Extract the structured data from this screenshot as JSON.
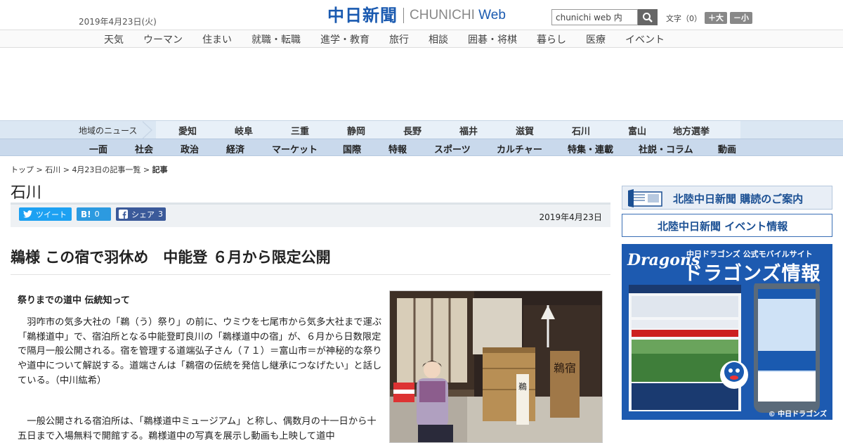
{
  "header": {
    "date": "2019年4月23日(火)",
    "logo_jp": "中日新聞",
    "logo_en_prefix": "CHUNICHI",
    "logo_en_suffix": "Web",
    "search_value": "chunichi web 内",
    "fontsize_label": "文字（0）",
    "font_larger": "＋大",
    "font_smaller": "－小"
  },
  "nav_top": [
    "天気",
    "ウーマン",
    "住まい",
    "就職・転職",
    "進学・教育",
    "旅行",
    "相談",
    "囲碁・将棋",
    "暮らし",
    "医療",
    "イベント"
  ],
  "nav_region": {
    "label": "地域のニュース",
    "items": [
      "愛知",
      "岐阜",
      "三重",
      "静岡",
      "長野",
      "福井",
      "滋賀",
      "石川",
      "富山",
      "地方選挙"
    ]
  },
  "nav_category": [
    "一面",
    "社会",
    "政治",
    "経済",
    "マーケット",
    "国際",
    "特報",
    "スポーツ",
    "カルチャー",
    "特集・連載",
    "社説・コラム",
    "動画"
  ],
  "breadcrumb": {
    "top": "トップ",
    "region": "石川",
    "list": "4月23日の記事一覧",
    "current": "記事",
    "sep": " > "
  },
  "section_title": "石川",
  "share": {
    "tweet": "ツイート",
    "hatena_count": "0",
    "facebook": "シェア",
    "facebook_count": "3",
    "date": "2019年4月23日"
  },
  "article": {
    "headline": "鵜様 この宿で羽休め　中能登 ６月から限定公開",
    "subhead": "祭りまでの道中 伝統知って",
    "p1": "　羽咋市の気多大社の「鵜（う）祭り」の前に、ウミウを七尾市から気多大社まで運ぶ「鵜様道中」で、宿泊所となる中能登町良川の「鵜様道中の宿」が、６月から日数限定で隔月一般公開される。宿を管理する道端弘子さん（７１）＝富山市＝が神秘的な祭りや道中について解説する。道端さんは「鵜宿の伝統を発信し継承につなげたい」と話している。（中川紘希）",
    "p2": "　一般公開される宿泊所は、「鵜様道中ミュージアム」と称し、偶数月の十一日から十五日まで入場無料で開館する。鵜様道中の写真を展示し動画も上映して道中"
  },
  "photo": {
    "sign_text": "鵜宿",
    "box_text": "鵜"
  },
  "sidebar": {
    "subscribe": "北陸中日新聞 購読のご案内",
    "events": "北陸中日新聞 イベント情報",
    "dragons_brand": "Dragons",
    "dragons_sub": "中日ドラゴンズ 公式モバイルサイト",
    "dragons_title": "ドラゴンズ情報",
    "dragons_copy": "© 中日ドラゴンズ"
  },
  "colors": {
    "brand_blue": "#1a5ab0",
    "twitter": "#1da1f2",
    "hatena": "#2c9ae0",
    "facebook": "#3b5a9a"
  }
}
